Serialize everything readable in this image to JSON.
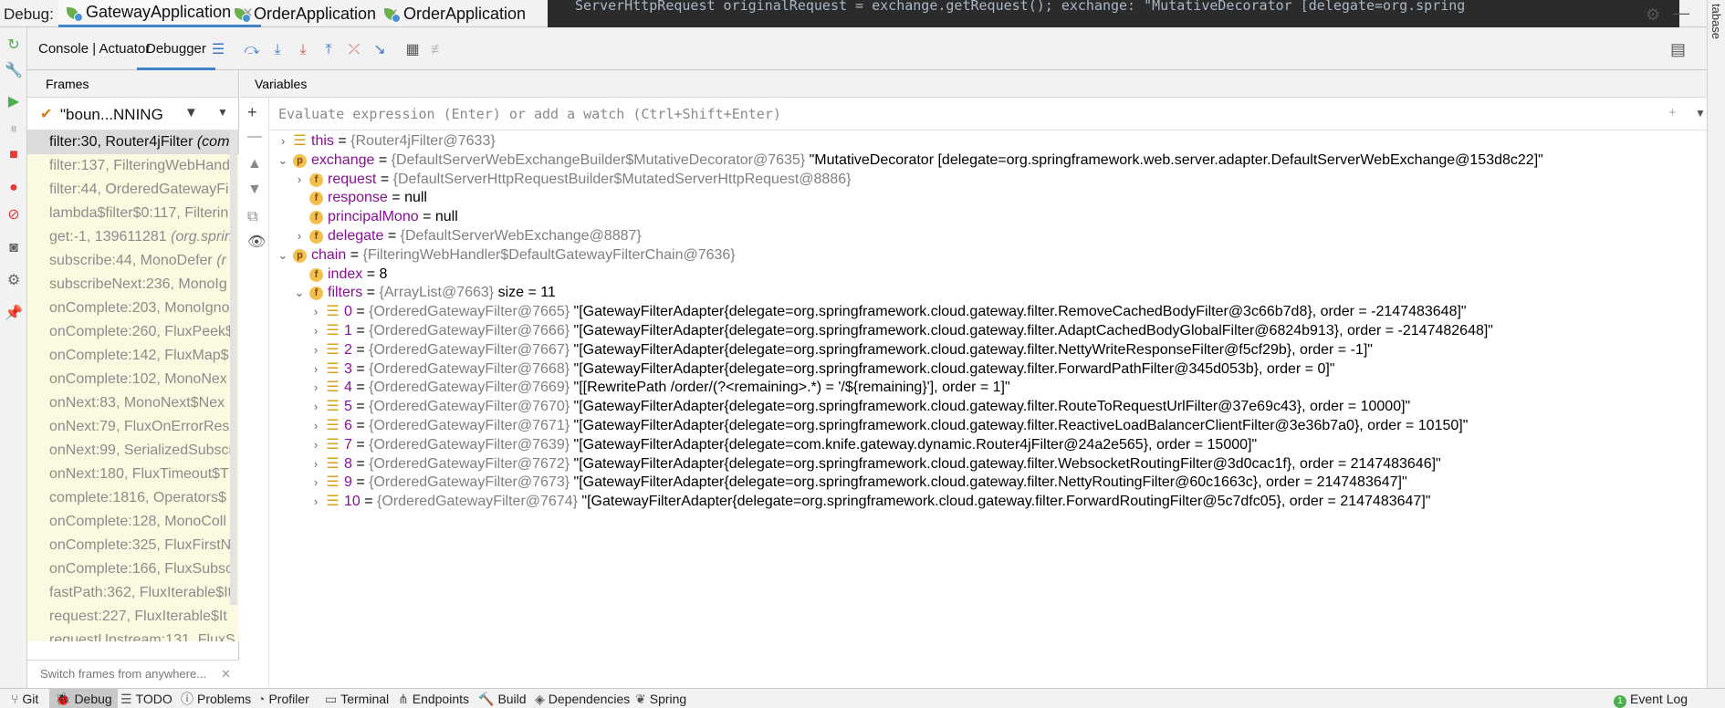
{
  "debug_label": "Debug:",
  "run_tabs": [
    {
      "label": "GatewayApplication"
    },
    {
      "label": "OrderApplication"
    },
    {
      "label": "OrderApplication"
    }
  ],
  "code_peek": "ServerHttpRequest originalRequest = exchange.getRequest();   exchange: \"MutativeDecorator [delegate=org.spring",
  "right_stripe_label": "tabase",
  "sub_tabs": {
    "console": "Console | Actuator",
    "debugger": "Debugger"
  },
  "frames": {
    "header": "Frames",
    "thread": "\"boun...NNING",
    "items": [
      {
        "text": "filter:30, Router4jFilter",
        "em": "(com"
      },
      {
        "text": "filter:137, FilteringWebHand",
        "em": ""
      },
      {
        "text": "filter:44, OrderedGatewayFi",
        "em": ""
      },
      {
        "text": "lambda$filter$0:117, Filterin",
        "em": ""
      },
      {
        "text": "get:-1, 139611281",
        "em": "(org.sprin"
      },
      {
        "text": "subscribe:44, MonoDefer",
        "em": "(r"
      },
      {
        "text": "subscribeNext:236, MonoIg",
        "em": ""
      },
      {
        "text": "onComplete:203, MonoIgno",
        "em": ""
      },
      {
        "text": "onComplete:260, FluxPeek$",
        "em": ""
      },
      {
        "text": "onComplete:142, FluxMap$",
        "em": ""
      },
      {
        "text": "onComplete:102, MonoNex",
        "em": ""
      },
      {
        "text": "onNext:83, MonoNext$Nex",
        "em": ""
      },
      {
        "text": "onNext:79, FluxOnErrorResu",
        "em": ""
      },
      {
        "text": "onNext:99, SerializedSubscr",
        "em": ""
      },
      {
        "text": "onNext:180, FluxTimeout$T",
        "em": ""
      },
      {
        "text": "complete:1816, Operators$",
        "em": ""
      },
      {
        "text": "onComplete:128, MonoColl",
        "em": ""
      },
      {
        "text": "onComplete:325, FluxFirstN",
        "em": ""
      },
      {
        "text": "onComplete:166, FluxSubsc",
        "em": ""
      },
      {
        "text": "fastPath:362, FluxIterable$It",
        "em": ""
      },
      {
        "text": "request:227, FluxIterable$It",
        "em": ""
      },
      {
        "text": "requestUpstream:131, FluxS",
        "em": ""
      }
    ],
    "footer": "Switch frames from anywhere..."
  },
  "variables": {
    "header": "Variables",
    "watch_placeholder": "Evaluate expression (Enter) or add a watch (Ctrl+Shift+Enter)",
    "tree": [
      {
        "name": "this",
        "type": "{Router4jFilter@7633}",
        "value": "",
        "kind": "list"
      },
      {
        "name": "exchange",
        "type": "{DefaultServerWebExchangeBuilder$MutativeDecorator@7635}",
        "value": "\"MutativeDecorator [delegate=org.springframework.web.server.adapter.DefaultServerWebExchange@153d8c22]\"",
        "kind": "p"
      },
      {
        "name": "request",
        "type": "{DefaultServerHttpRequestBuilder$MutatedServerHttpRequest@8886}",
        "value": "",
        "kind": "f"
      },
      {
        "name": "response",
        "type": "",
        "value": "= null",
        "kind": "f"
      },
      {
        "name": "principalMono",
        "type": "",
        "value": "= null",
        "kind": "f"
      },
      {
        "name": "delegate",
        "type": "{DefaultServerWebExchange@8887}",
        "value": "",
        "kind": "f"
      },
      {
        "name": "chain",
        "type": "{FilteringWebHandler$DefaultGatewayFilterChain@7636}",
        "value": "",
        "kind": "p"
      },
      {
        "name": "index",
        "type": "",
        "value": "= 8",
        "kind": "f"
      },
      {
        "name": "filters",
        "type": "{ArrayList@7663}",
        "value": "size = 11",
        "kind": "f"
      },
      {
        "name": "0",
        "type": "{OrderedGatewayFilter@7665}",
        "value": "\"[GatewayFilterAdapter{delegate=org.springframework.cloud.gateway.filter.RemoveCachedBodyFilter@3c66b7d8}, order = -2147483648]\"",
        "kind": "list"
      },
      {
        "name": "1",
        "type": "{OrderedGatewayFilter@7666}",
        "value": "\"[GatewayFilterAdapter{delegate=org.springframework.cloud.gateway.filter.AdaptCachedBodyGlobalFilter@6824b913}, order = -2147482648]\"",
        "kind": "list"
      },
      {
        "name": "2",
        "type": "{OrderedGatewayFilter@7667}",
        "value": "\"[GatewayFilterAdapter{delegate=org.springframework.cloud.gateway.filter.NettyWriteResponseFilter@f5cf29b}, order = -1]\"",
        "kind": "list"
      },
      {
        "name": "3",
        "type": "{OrderedGatewayFilter@7668}",
        "value": "\"[GatewayFilterAdapter{delegate=org.springframework.cloud.gateway.filter.ForwardPathFilter@345d053b}, order = 0]\"",
        "kind": "list"
      },
      {
        "name": "4",
        "type": "{OrderedGatewayFilter@7669}",
        "value": "\"[[RewritePath /order/(?<remaining>.*) = '/${remaining}'], order = 1]\"",
        "kind": "list"
      },
      {
        "name": "5",
        "type": "{OrderedGatewayFilter@7670}",
        "value": "\"[GatewayFilterAdapter{delegate=org.springframework.cloud.gateway.filter.RouteToRequestUrlFilter@37e69c43}, order = 10000]\"",
        "kind": "list"
      },
      {
        "name": "6",
        "type": "{OrderedGatewayFilter@7671}",
        "value": "\"[GatewayFilterAdapter{delegate=org.springframework.cloud.gateway.filter.ReactiveLoadBalancerClientFilter@3e36b7a0}, order = 10150]\"",
        "kind": "list"
      },
      {
        "name": "7",
        "type": "{OrderedGatewayFilter@7639}",
        "value": "\"[GatewayFilterAdapter{delegate=com.knife.gateway.dynamic.Router4jFilter@24a2e565}, order = 15000]\"",
        "kind": "list"
      },
      {
        "name": "8",
        "type": "{OrderedGatewayFilter@7672}",
        "value": "\"[GatewayFilterAdapter{delegate=org.springframework.cloud.gateway.filter.WebsocketRoutingFilter@3d0cac1f}, order = 2147483646]\"",
        "kind": "list"
      },
      {
        "name": "9",
        "type": "{OrderedGatewayFilter@7673}",
        "value": "\"[GatewayFilterAdapter{delegate=org.springframework.cloud.gateway.filter.NettyRoutingFilter@60c1663c}, order = 2147483647]\"",
        "kind": "list"
      },
      {
        "name": "10",
        "type": "{OrderedGatewayFilter@7674}",
        "value": "\"[GatewayFilterAdapter{delegate=org.springframework.cloud.gateway.filter.ForwardRoutingFilter@5c7dfc05}, order = 2147483647]\"",
        "kind": "list"
      }
    ]
  },
  "bottom_tabs": [
    {
      "label": "Git",
      "icon": "branch-icon"
    },
    {
      "label": "Debug",
      "icon": "bug-icon"
    },
    {
      "label": "TODO",
      "icon": "list-icon"
    },
    {
      "label": "Problems",
      "icon": "info-icon"
    },
    {
      "label": "Profiler",
      "icon": "profiler-icon"
    },
    {
      "label": "Terminal",
      "icon": "terminal-icon"
    },
    {
      "label": "Endpoints",
      "icon": "endpoints-icon"
    },
    {
      "label": "Build",
      "icon": "hammer-icon"
    },
    {
      "label": "Dependencies",
      "icon": "layers-icon"
    },
    {
      "label": "Spring",
      "icon": "spring-icon"
    }
  ],
  "event_log": {
    "label": "Event Log",
    "badge": "1"
  }
}
